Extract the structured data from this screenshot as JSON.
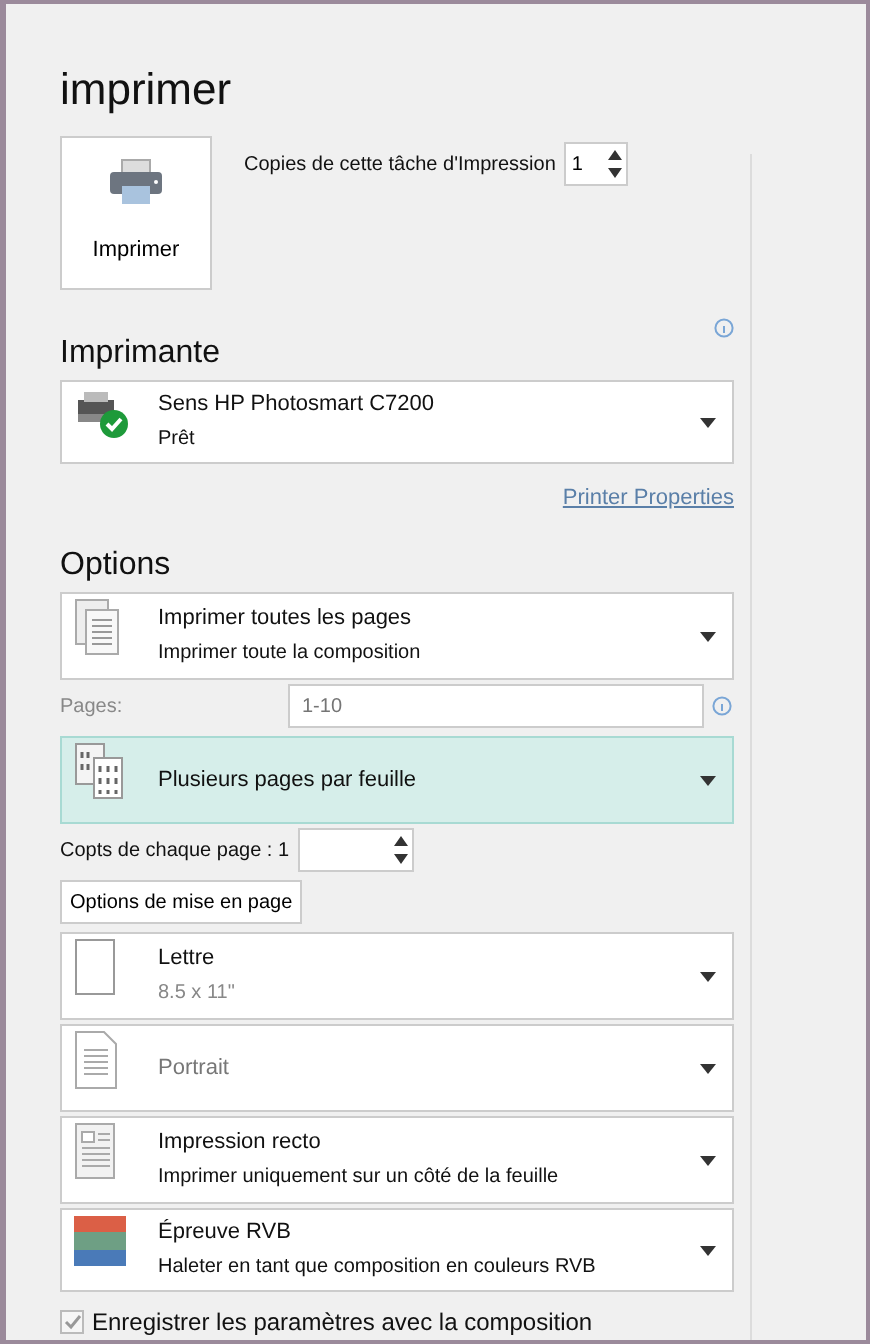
{
  "title": "imprimer",
  "print_button": {
    "label": "Imprimer"
  },
  "copies": {
    "label": "Copies de cette tâche d'Impression",
    "value": "1"
  },
  "printer_section": {
    "heading": "Imprimante",
    "printer": {
      "kind": "printer",
      "line1": "Sens HP Photosmart C7200",
      "line2": "Prêt"
    },
    "properties_link": "Printer Properties"
  },
  "options_section": {
    "heading": "Options",
    "dropdowns": [
      {
        "kind": "pages",
        "line1": "Imprimer toutes les pages",
        "line2": "Imprimer toute la composition",
        "highlighted": false,
        "disabled": false
      },
      {
        "kind": "pages_field",
        "label": "Pages:",
        "placeholder": "1-10"
      },
      {
        "kind": "multi",
        "line1": "Plusieurs pages par feuille",
        "highlighted": true,
        "disabled": false
      },
      {
        "kind": "copies_per_page",
        "label": "Copts de chaque page : 1"
      },
      {
        "kind": "layout_button",
        "label": "Options de mise en page"
      },
      {
        "kind": "paper",
        "line1": "Lettre",
        "line2": "8.5 x 11\"",
        "highlighted": false,
        "disabled": false
      },
      {
        "kind": "portrait",
        "line1": "Portrait",
        "highlighted": false,
        "disabled": true
      },
      {
        "kind": "duplex",
        "line1": "Impression recto",
        "line2": "Imprimer uniquement sur un côté de la feuille",
        "highlighted": false,
        "disabled": false
      },
      {
        "kind": "color",
        "line1": "Épreuve RVB",
        "line2": "Haleter en tant que composition en couleurs RVB",
        "highlighted": false,
        "disabled": false
      }
    ]
  },
  "save_settings": {
    "label": "Enregistrer les paramètres avec la composition",
    "checked": true,
    "disabled": true
  }
}
